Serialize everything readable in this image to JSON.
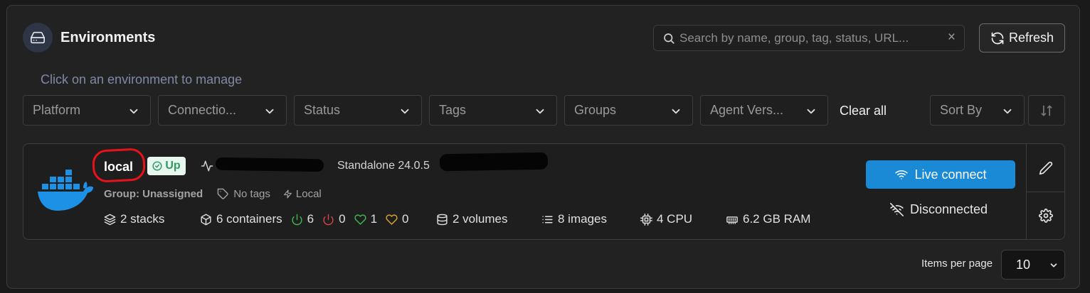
{
  "header": {
    "title": "Environments",
    "icon": "server-drive-icon",
    "search_placeholder": "Search by name, group, tag, status, URL...",
    "refresh_label": "Refresh"
  },
  "subtitle": "Click on an environment to manage",
  "filters": {
    "platform": "Platform",
    "connection": "Connectio...",
    "status": "Status",
    "tags": "Tags",
    "groups": "Groups",
    "agent_version": "Agent Vers...",
    "clear_all": "Clear all",
    "sort_by": "Sort By"
  },
  "environment": {
    "name": "local",
    "status": "Up",
    "type": "Standalone 24.0.5",
    "group": "Group: Unassigned",
    "tags": "No tags",
    "connection_type": "Local",
    "stacks": "2 stacks",
    "containers": "6 containers",
    "running": "6",
    "stopped": "0",
    "healthy": "1",
    "unhealthy": "0",
    "volumes": "2 volumes",
    "images": "8 images",
    "cpu": "4 CPU",
    "ram": "6.2 GB RAM",
    "live_connect": "Live connect",
    "connection_state": "Disconnected"
  },
  "pagination": {
    "items_per_page_label": "Items per page",
    "items_per_page": "10"
  },
  "colors": {
    "accent": "#1a8ad6",
    "up_badge_bg": "#e7f7ee",
    "up_badge_text": "#2f9a62",
    "running": "#3fb950",
    "stopped": "#d64545",
    "healthy": "#3fb950",
    "unhealthy": "#e0a32e",
    "docker_blue": "#1d91e6",
    "annotation_red": "#e8121a"
  }
}
